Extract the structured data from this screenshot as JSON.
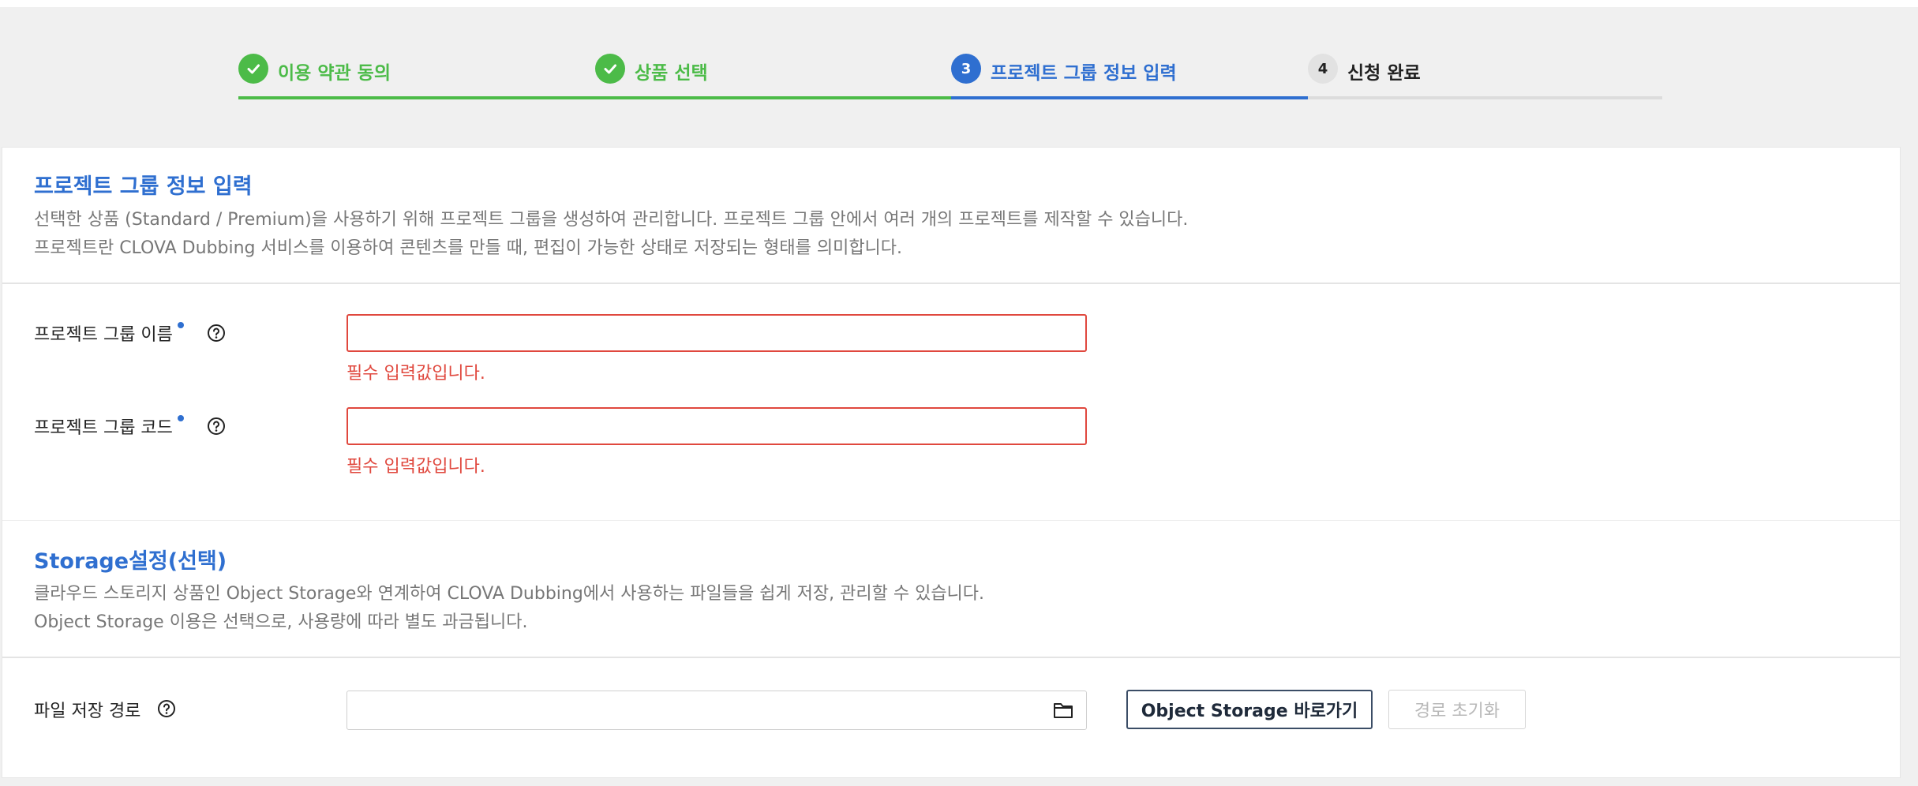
{
  "stepper": {
    "steps": [
      {
        "number": "1",
        "label": "이용 약관 동의",
        "state": "done"
      },
      {
        "number": "2",
        "label": "상품 선택",
        "state": "done"
      },
      {
        "number": "3",
        "label": "프로젝트 그룹 정보 입력",
        "state": "current"
      },
      {
        "number": "4",
        "label": "신청 완료",
        "state": "todo"
      }
    ]
  },
  "project_info": {
    "title": "프로젝트 그룹 정보 입력",
    "desc_line1": "선택한 상품 (Standard / Premium)을 사용하기 위해 프로젝트 그룹을 생성하여 관리합니다. 프로젝트 그룹 안에서 여러 개의 프로젝트를 제작할 수 있습니다.",
    "desc_line2": "프로젝트란 CLOVA Dubbing 서비스를 이용하여 콘텐츠를 만들 때, 편집이 가능한 상태로 저장되는 형태를 의미합니다.",
    "name_field": {
      "label": "프로젝트 그룹 이름",
      "value": "",
      "error": "필수 입력값입니다."
    },
    "code_field": {
      "label": "프로젝트 그룹 코드",
      "value": "",
      "error": "필수 입력값입니다."
    }
  },
  "storage": {
    "title": "Storage설정(선택)",
    "desc_line1": "클라우드 스토리지 상품인 Object Storage와 연계하여 CLOVA Dubbing에서 사용하는 파일들을 쉽게 저장, 관리할 수 있습니다.",
    "desc_line2": "Object Storage 이용은 선택으로, 사용량에 따라 별도 과금됩니다.",
    "path_field": {
      "label": "파일 저장 경로",
      "value": ""
    },
    "goto_button": "Object Storage 바로가기",
    "reset_button": "경로 초기화"
  },
  "colors": {
    "done": "#4cbb48",
    "current": "#2f6fd0",
    "error": "#e0483e"
  },
  "icons": [
    "check-icon",
    "help-icon",
    "folder-icon"
  ]
}
